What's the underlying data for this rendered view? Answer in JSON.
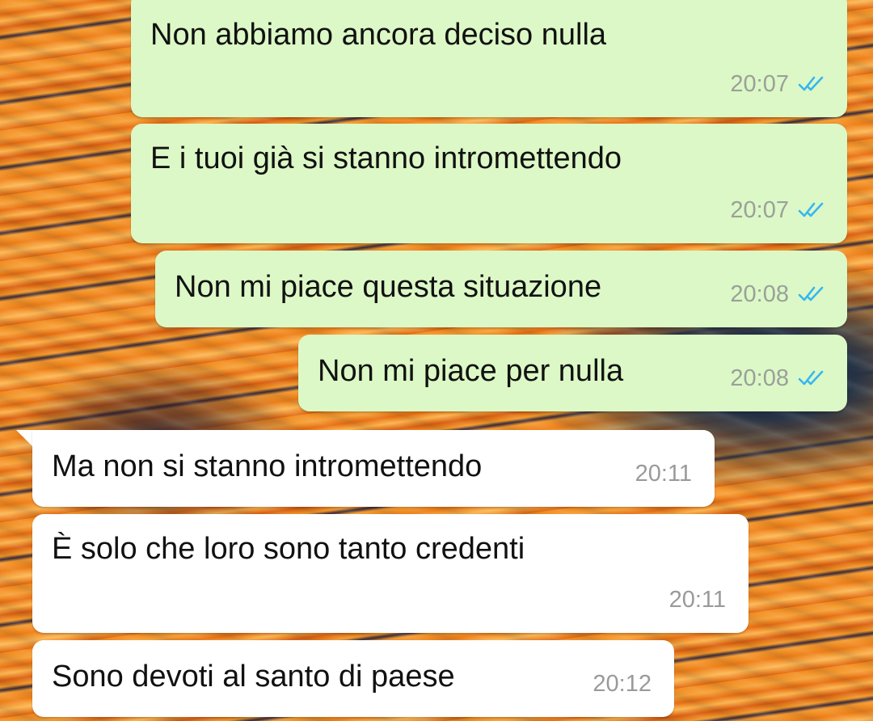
{
  "chat": {
    "messages": [
      {
        "direction": "outgoing",
        "text": "Non abbiamo ancora deciso nulla",
        "time": "20:07",
        "status": "read"
      },
      {
        "direction": "outgoing",
        "text": "E i tuoi già si stanno intromettendo",
        "time": "20:07",
        "status": "read"
      },
      {
        "direction": "outgoing",
        "text": "Non mi piace questa situazione",
        "time": "20:08",
        "status": "read"
      },
      {
        "direction": "outgoing",
        "text": "Non mi piace per nulla",
        "time": "20:08",
        "status": "read"
      },
      {
        "direction": "incoming",
        "text": "Ma non si stanno intromettendo",
        "time": "20:11"
      },
      {
        "direction": "incoming",
        "text": "È solo che loro sono tanto credenti",
        "time": "20:11"
      },
      {
        "direction": "incoming",
        "text": "Sono devoti al santo di paese",
        "time": "20:12"
      }
    ]
  },
  "colors": {
    "outgoing_bubble": "#dcf8c6",
    "incoming_bubble": "#ffffff",
    "read_check": "#34b7f1",
    "timestamp": "#9aa09a"
  },
  "icons": {
    "read_receipt": "double-check-icon"
  }
}
